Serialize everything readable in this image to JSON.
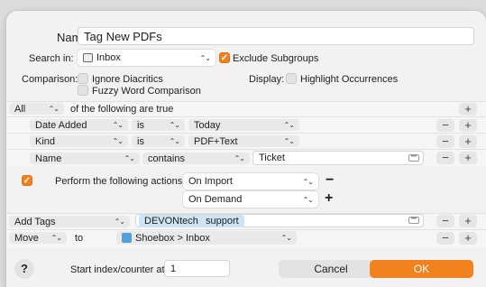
{
  "name": {
    "label": "Name:",
    "value": "Tag New PDFs"
  },
  "search_in": {
    "label": "Search in:",
    "value": "Inbox",
    "icon": "inbox-icon"
  },
  "exclude_subgroups": {
    "label": "Exclude Subgroups",
    "checked": true
  },
  "comparison": {
    "label": "Comparison:",
    "options": [
      {
        "label": "Ignore Diacritics",
        "checked": false
      },
      {
        "label": "Fuzzy Word Comparison",
        "checked": false
      }
    ]
  },
  "display": {
    "label": "Display:",
    "option": {
      "label": "Highlight Occurrences",
      "checked": false
    }
  },
  "match": {
    "mode": "All",
    "text": "of the following are true"
  },
  "conditions": [
    {
      "field": "Date Added",
      "operator": "is",
      "value": "Today"
    },
    {
      "field": "Kind",
      "operator": "is",
      "value": "PDF+Text"
    },
    {
      "field": "Name",
      "operator": "contains",
      "value": "Ticket"
    }
  ],
  "perform": {
    "checked": true,
    "label": "Perform the following actions:",
    "triggers": [
      "On Import",
      "On Demand"
    ]
  },
  "actions": [
    {
      "action": "Add Tags",
      "tags": [
        "DEVONtech",
        "support"
      ]
    },
    {
      "action": "Move",
      "connector": "to",
      "destination": "Shoebox > Inbox",
      "icon": "database-icon"
    }
  ],
  "footer": {
    "help": "?",
    "counter_label": "Start index/counter at:",
    "counter_value": "1",
    "cancel": "Cancel",
    "ok": "OK"
  },
  "buttons": {
    "plus": "+",
    "minus": "−"
  },
  "colors": {
    "accent": "#F2821E",
    "tag_bg": "#CFE4F3"
  }
}
